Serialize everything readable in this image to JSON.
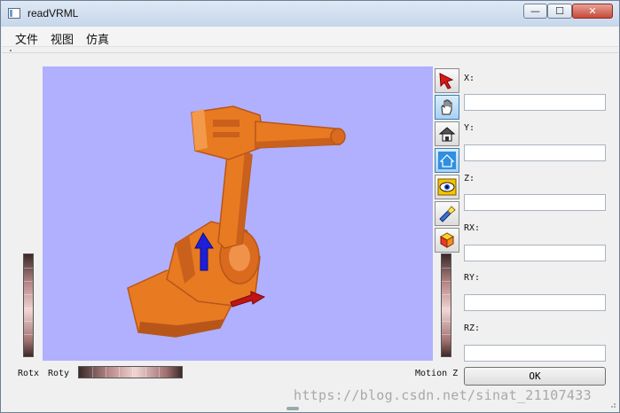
{
  "window": {
    "title": "readVRML",
    "min_glyph": "—",
    "max_glyph": "☐",
    "close_glyph": "✕"
  },
  "menu": {
    "items": [
      "文件",
      "视图",
      "仿真"
    ]
  },
  "toolbar_icons": [
    "select-arrow-icon",
    "hand-pan-icon",
    "home-icon",
    "house-outline-icon",
    "eye-view-icon",
    "flashlight-icon",
    "cube-icon"
  ],
  "fields": [
    {
      "label": "X:",
      "value": ""
    },
    {
      "label": "Y:",
      "value": ""
    },
    {
      "label": "Z:",
      "value": ""
    },
    {
      "label": "RX:",
      "value": ""
    },
    {
      "label": "RY:",
      "value": ""
    },
    {
      "label": "RZ:",
      "value": ""
    }
  ],
  "labels": {
    "rotx": "Rotx",
    "roty": "Roty",
    "motion_z": "Motion Z"
  },
  "ok_label": "OK",
  "watermark": "https://blog.csdn.net/sinat_21107433",
  "colors": {
    "viewport_bg": "#b0b0ff",
    "robot": "#e87a22",
    "robot_shadow": "#b8561a",
    "arrow_up": "#1f1fd8",
    "arrow_right": "#c01414"
  }
}
